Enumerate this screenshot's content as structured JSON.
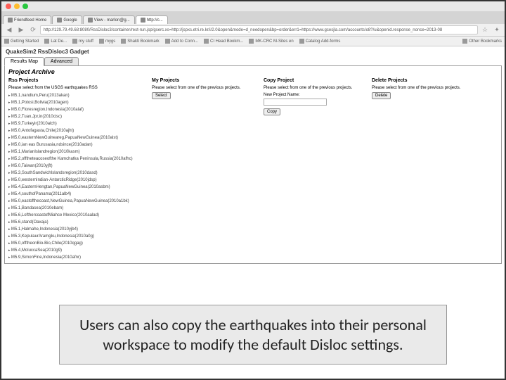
{
  "mac": {
    "red": "",
    "yellow": "",
    "green": ""
  },
  "browser_tabs": [
    {
      "label": "Friendfeed Home"
    },
    {
      "label": "Google"
    },
    {
      "label": "View - marlon@g..."
    },
    {
      "label": "http://c..."
    }
  ],
  "url": "http://129.79.49.68:8080/RssDisloc3/container/rest-run.jsp/gserc.xs=http://jspxs.etri.re.kr/i/2.0&open&mode=d_needopen&bp=order&err1=https://www.gcesjla.com/accounts/o8?/u&openid.response_nonce=2013-08",
  "bookmarks": {
    "items": [
      {
        "label": "Getting Started"
      },
      {
        "label": "Lat De..."
      },
      {
        "label": "my stuff"
      },
      {
        "label": "mygs"
      },
      {
        "label": "Shakti Bookmark"
      },
      {
        "label": "Add to Conn..."
      },
      {
        "label": "CI Head Bookm..."
      },
      {
        "label": "MK-CRC M-Sites en"
      },
      {
        "label": "Catalog Add-forms"
      }
    ],
    "other": "Other Bookmarks"
  },
  "app": {
    "title": "QuakeSim2 RssDisloc3 Gadget",
    "tabs": [
      {
        "label": "Results Map"
      },
      {
        "label": "Advanced"
      }
    ],
    "panel_title": "Project Archive"
  },
  "cols": {
    "rss": {
      "header": "Rss Projects",
      "sub": "Please select from the USGS earthquakes RSS",
      "items": [
        "M5.1,nandium,Peru(2013akan)",
        "M5.1,Potosi,Bolivia(2010agen)",
        "M5.0,Floresregion,Indonesia(2010alaf)",
        "M5.2,Tuan,Jpr,in(2010cisc)",
        "M5.9,Turkeyir(2010alch)",
        "M5.0,Antofagasta,Chile(2010ajht)",
        "M5.0,easternNewGuineareg,PapuaNewGuinea(2010alst)",
        "M5.0,ian eas Burusasia,ndsince(2010adan)",
        "M5.1,MarianIslandregion(2010kasm)",
        "M5.2,offtheteacoseofthe Kamchatka Peninsula,Russia(2010afhc)",
        "M5.0,Taiwan(2010yjft)",
        "M5.3,SouthSandwichIslandsregion(2010dasd)",
        "M5.0,westernIndian-AntarcticRidge(2010jdsp)",
        "M5.4,EasternHengtan,PapuaNewGuinea(2010asbm)",
        "M5.4,southofPanama(2011alb4)",
        "M5.0,eastofthecoast,NewGuinea,PapuaNewGuinea(2010a1bk)",
        "M5.1,Bandasea(2010ebam)",
        "M5.6,LofthercoastofMiahce Mexico(2010aalad)",
        "M5.6,stand(Oaxaja)",
        "M5.1,Halmahe,Indonesia(2010yjb4)",
        "M5.3,KepulaurAramgku,Indonesia(2010a0g)",
        "M5.0,offtheonBio-Bio,Chile(2010qgag)",
        "M5.4,MoluccaSea(2010g9)",
        "M5.9,SimonFine,Indonesia(2010afnr)"
      ]
    },
    "my": {
      "header": "My Projects",
      "sub": "Please select from one of the previous projects.",
      "btn": "Select"
    },
    "copy": {
      "header": "Copy Project",
      "sub": "Please select from one of the previous projects.",
      "label": "New Project Name:",
      "btn": "Copy"
    },
    "del": {
      "header": "Delete Projects",
      "sub": "Please select from one of the previous projects.",
      "btn": "Delete"
    }
  },
  "caption": "Users can also copy the earthquakes into their personal workspace to modify the default Disloc settings."
}
